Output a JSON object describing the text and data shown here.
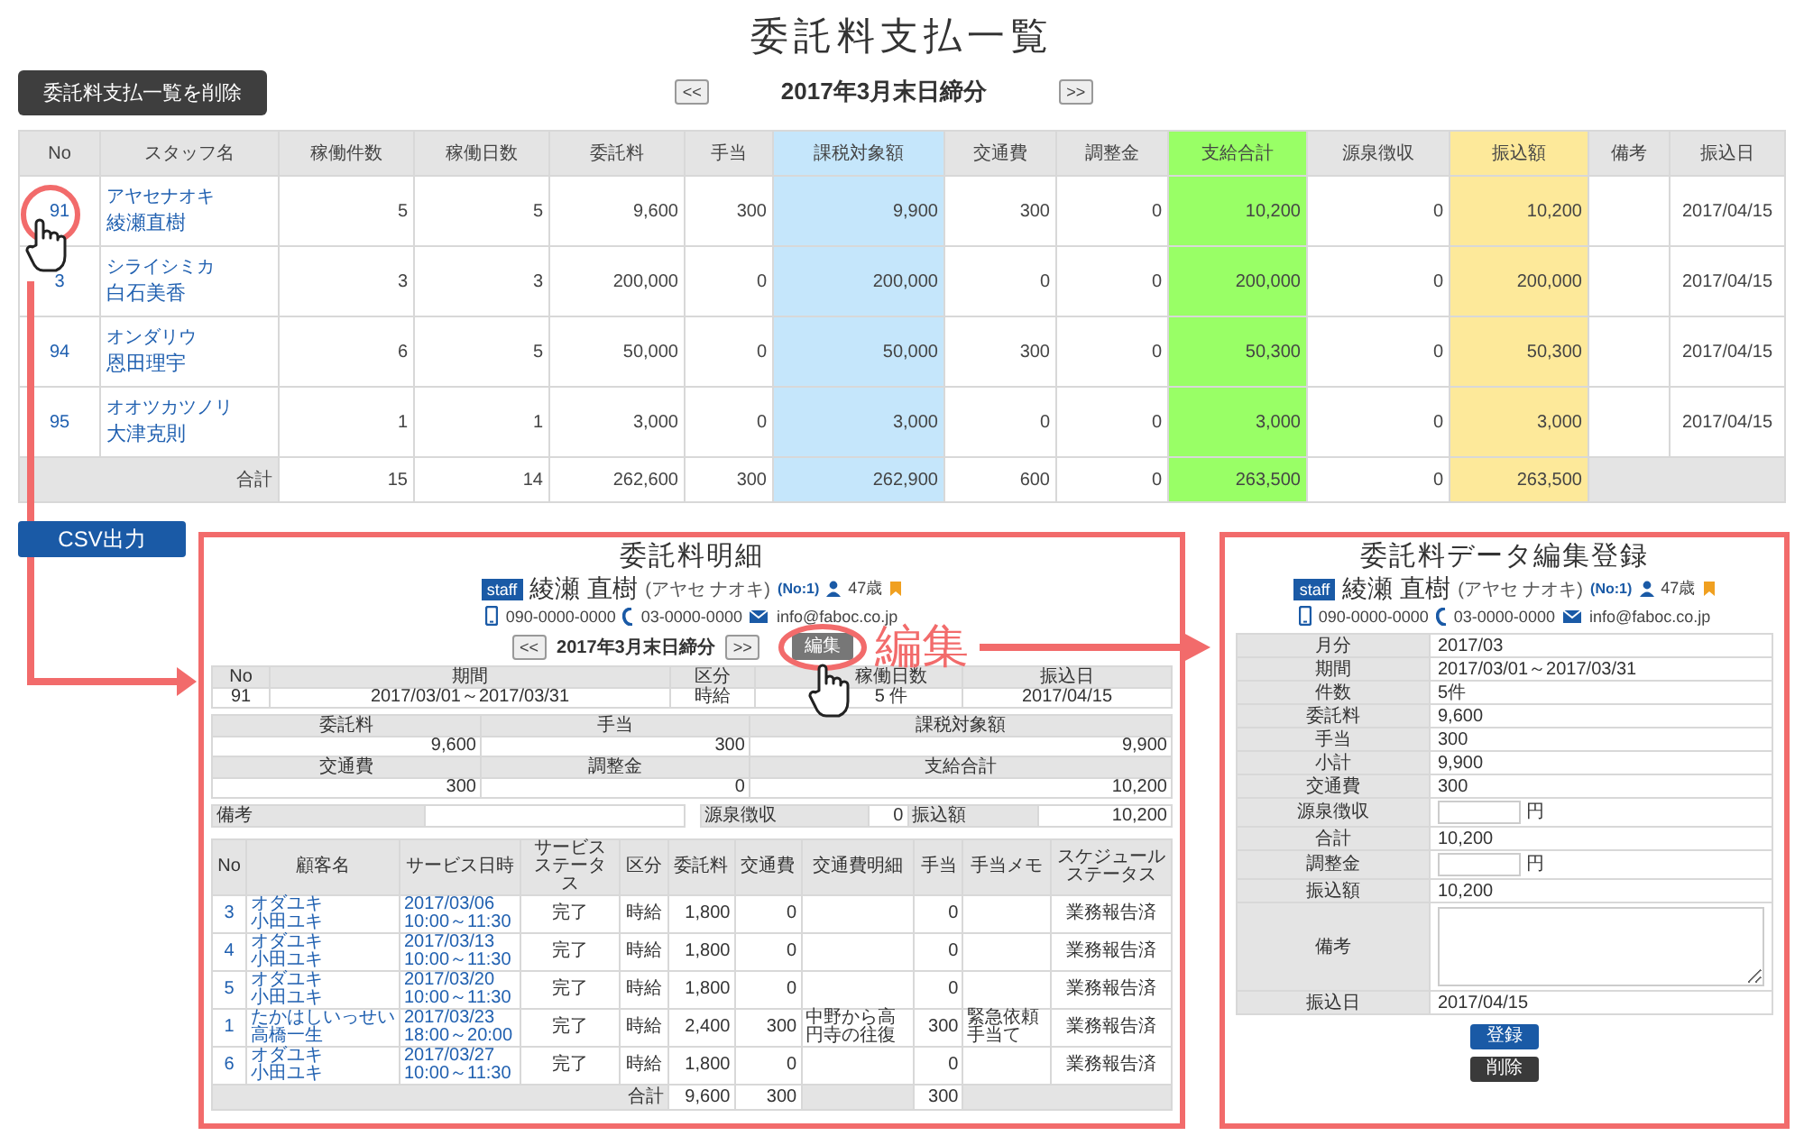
{
  "page_title": "委託料支払一覧",
  "delete_button": "委託料支払一覧を削除",
  "period_nav": {
    "prev": "<<",
    "label": "2017年3月末日締分",
    "next": ">>"
  },
  "summary_table": {
    "columns": [
      {
        "label": "No"
      },
      {
        "label": "スタッフ名"
      },
      {
        "label": "稼働件数"
      },
      {
        "label": "稼働日数"
      },
      {
        "label": "委託料"
      },
      {
        "label": "手当"
      },
      {
        "label": "課税対象額",
        "color": "#c5e6fb"
      },
      {
        "label": "交通費"
      },
      {
        "label": "調整金"
      },
      {
        "label": "支給合計",
        "color": "#99ff66"
      },
      {
        "label": "源泉徴収"
      },
      {
        "label": "振込額",
        "color": "#fde99a"
      },
      {
        "label": "備考"
      },
      {
        "label": "振込日"
      }
    ],
    "rows": [
      {
        "no": "91",
        "kana": "アヤセナオキ",
        "name": "綾瀬直樹",
        "values": [
          "5",
          "5",
          "9,600",
          "300",
          "9,900",
          "300",
          "0",
          "10,200",
          "0",
          "10,200"
        ],
        "transfer_date": "2017/04/15"
      },
      {
        "no": "3",
        "kana": "シライシミカ",
        "name": "白石美香",
        "values": [
          "3",
          "3",
          "200,000",
          "0",
          "200,000",
          "0",
          "0",
          "200,000",
          "0",
          "200,000"
        ],
        "transfer_date": "2017/04/15"
      },
      {
        "no": "94",
        "kana": "オンダリウ",
        "name": "恩田理宇",
        "values": [
          "6",
          "5",
          "50,000",
          "0",
          "50,000",
          "300",
          "0",
          "50,300",
          "0",
          "50,300"
        ],
        "transfer_date": "2017/04/15"
      },
      {
        "no": "95",
        "kana": "オオツカツノリ",
        "name": "大津克則",
        "values": [
          "1",
          "1",
          "3,000",
          "0",
          "3,000",
          "0",
          "0",
          "3,000",
          "0",
          "3,000"
        ],
        "transfer_date": "2017/04/15"
      }
    ],
    "total": {
      "label": "合計",
      "values": [
        "15",
        "14",
        "262,600",
        "300",
        "262,900",
        "600",
        "0",
        "263,500",
        "0",
        "263,500"
      ]
    }
  },
  "csv_button": "CSV出力",
  "detail_panel": {
    "title": "委託料明細",
    "staff": {
      "badge": "staff",
      "name": "綾瀬 直樹",
      "kana": "(アヤセ ナオキ)",
      "number": "(No:1)",
      "age": "47歳",
      "mobile": "090-0000-0000",
      "phone": "03-0000-0000",
      "email": "info@faboc.co.jp"
    },
    "nav": {
      "prev": "<<",
      "label": "2017年3月末日締分",
      "next": ">>"
    },
    "edit_button": "編集",
    "info_columns": [
      {
        "label": "No",
        "value": "91"
      },
      {
        "label": "期間",
        "value": "2017/03/01～2017/03/31"
      },
      {
        "label": "区分",
        "value": "時給"
      },
      {
        "label": "稼働日数",
        "value": "5 件"
      },
      {
        "label": "振込日",
        "value": "2017/04/15"
      }
    ],
    "amounts": [
      {
        "label": "委託料",
        "value": "9,600"
      },
      {
        "label": "手当",
        "value": "300"
      },
      {
        "label": "課税対象額",
        "value": "9,900"
      },
      {
        "label": "交通費",
        "value": "300"
      },
      {
        "label": "調整金",
        "value": "0"
      },
      {
        "label": "支給合計",
        "value": "10,200"
      }
    ],
    "remarks_label": "備考",
    "withholding": {
      "label": "源泉徴収",
      "value": "0"
    },
    "transfer": {
      "label": "振込額",
      "value": "10,200"
    },
    "services": {
      "columns": [
        "No",
        "顧客名",
        "サービス日時",
        "サービスステータス",
        "区分",
        "委託料",
        "交通費",
        "交通費明細",
        "手当",
        "手当メモ",
        "スケジュールステータス"
      ],
      "rows": [
        {
          "no": "3",
          "customer_kana": "オダユキ",
          "customer": "小田ユキ",
          "date": "2017/03/06",
          "time": "10:00～11:30",
          "status": "完了",
          "type": "時給",
          "fee": "1,800",
          "transport": "0",
          "allowance": "0",
          "schedule_status": "業務報告済"
        },
        {
          "no": "4",
          "customer_kana": "オダユキ",
          "customer": "小田ユキ",
          "date": "2017/03/13",
          "time": "10:00～11:30",
          "status": "完了",
          "type": "時給",
          "fee": "1,800",
          "transport": "0",
          "allowance": "0",
          "schedule_status": "業務報告済"
        },
        {
          "no": "5",
          "customer_kana": "オダユキ",
          "customer": "小田ユキ",
          "date": "2017/03/20",
          "time": "10:00～11:30",
          "status": "完了",
          "type": "時給",
          "fee": "1,800",
          "transport": "0",
          "allowance": "0",
          "schedule_status": "業務報告済"
        },
        {
          "no": "1",
          "customer_kana": "たかはしいっせい",
          "customer": "高橋一生",
          "date": "2017/03/23",
          "time": "18:00～20:00",
          "status": "完了",
          "type": "時給",
          "fee": "2,400",
          "transport": "300",
          "transport_note": "中野から高円寺の往復",
          "allowance": "300",
          "allowance_note": "緊急依頼手当て",
          "schedule_status": "業務報告済"
        },
        {
          "no": "6",
          "customer_kana": "オダユキ",
          "customer": "小田ユキ",
          "date": "2017/03/27",
          "time": "10:00～11:30",
          "status": "完了",
          "type": "時給",
          "fee": "1,800",
          "transport": "0",
          "allowance": "0",
          "schedule_status": "業務報告済"
        }
      ],
      "total": {
        "label": "合計",
        "fee": "9,600",
        "transport": "300",
        "allowance": "300"
      }
    }
  },
  "annotation": {
    "label": "編集"
  },
  "edit_panel": {
    "title": "委託料データ編集登録",
    "staff": {
      "badge": "staff",
      "name": "綾瀬 直樹",
      "kana": "(アヤセ ナオキ)",
      "number": "(No:1)",
      "age": "47歳",
      "mobile": "090-0000-0000",
      "phone": "03-0000-0000",
      "email": "info@faboc.co.jp"
    },
    "rows": [
      {
        "kind": "text",
        "label": "月分",
        "value": "2017/03"
      },
      {
        "kind": "text",
        "label": "期間",
        "value": "2017/03/01～2017/03/31"
      },
      {
        "kind": "text",
        "label": "件数",
        "value": "5件"
      },
      {
        "kind": "text",
        "label": "委託料",
        "value": "9,600"
      },
      {
        "kind": "text",
        "label": "手当",
        "value": "300"
      },
      {
        "kind": "text",
        "label": "小計",
        "value": "9,900"
      },
      {
        "kind": "text",
        "label": "交通費",
        "value": "300"
      },
      {
        "kind": "input",
        "label": "源泉徴収",
        "unit": "円"
      },
      {
        "kind": "text",
        "label": "合計",
        "value": "10,200"
      },
      {
        "kind": "input",
        "label": "調整金",
        "unit": "円"
      },
      {
        "kind": "text",
        "label": "振込額",
        "value": "10,200"
      },
      {
        "kind": "textarea",
        "label": "備考"
      },
      {
        "kind": "text",
        "label": "振込日",
        "value": "2017/04/15"
      }
    ],
    "buttons": [
      {
        "label": "登録",
        "kind": "primary"
      },
      {
        "label": "削除",
        "kind": "dark"
      }
    ]
  }
}
